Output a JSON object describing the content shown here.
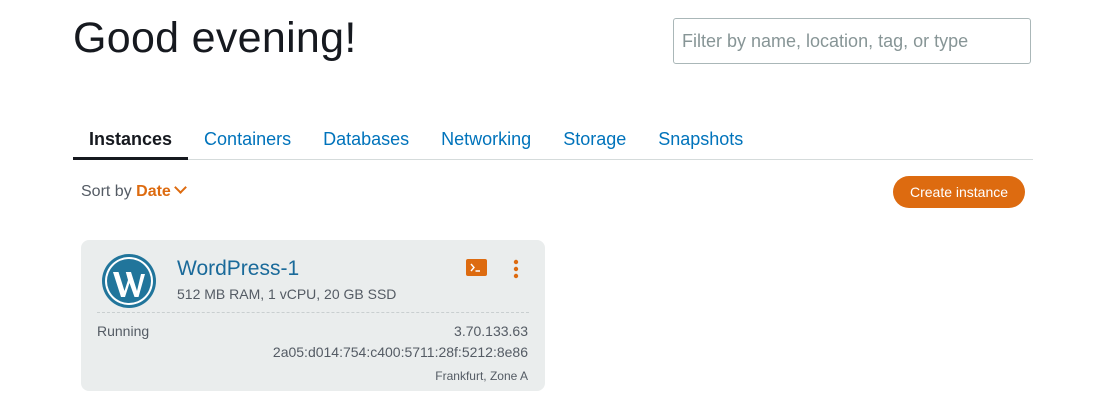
{
  "header": {
    "greeting": "Good evening!",
    "search_placeholder": "Filter by name, location, tag, or type"
  },
  "tabs": [
    {
      "label": "Instances",
      "active": true
    },
    {
      "label": "Containers",
      "active": false
    },
    {
      "label": "Databases",
      "active": false
    },
    {
      "label": "Networking",
      "active": false
    },
    {
      "label": "Storage",
      "active": false
    },
    {
      "label": "Snapshots",
      "active": false
    }
  ],
  "sort": {
    "label": "Sort by",
    "value": "Date",
    "icon": "chevron-down-icon"
  },
  "create_button": "Create instance",
  "instance": {
    "name": "WordPress-1",
    "specs": "512 MB RAM, 1 vCPU, 20 GB SSD",
    "state": "Running",
    "ipv4": "3.70.133.63",
    "ipv6": "2a05:d014:754:c400:5711:28f:5212:8e86",
    "location": "Frankfurt, Zone A",
    "logo_icon": "wordpress-logo-icon",
    "terminal_icon": "terminal-icon",
    "menu_icon": "more-vertical-icon"
  },
  "colors": {
    "accent": "#dd6b10",
    "link": "#0073bb",
    "card_bg": "#eaeded",
    "text": "#16191f",
    "muted": "#545b64",
    "wordpress_blue": "#21759b"
  }
}
